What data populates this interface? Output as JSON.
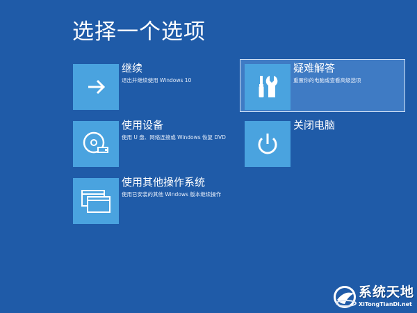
{
  "page": {
    "title": "选择一个选项"
  },
  "options": [
    {
      "title": "继续",
      "desc": "退出并继续使用 Windows 10",
      "icon": "arrow-right-icon"
    },
    {
      "title": "使用设备",
      "desc": "使用 U 盘、网络连接或 Windows 恢复 DVD",
      "icon": "disc-drive-icon"
    },
    {
      "title": "使用其他操作系统",
      "desc": "使用已安装的其他 Windows 版本继续操作",
      "icon": "windows-stack-icon"
    },
    {
      "title": "疑难解答",
      "desc": "重置你的电脑或查看高级选项",
      "icon": "tools-icon",
      "selected": true
    },
    {
      "title": "关闭电脑",
      "desc": "",
      "icon": "power-icon"
    }
  ],
  "watermark": {
    "title": "系统天地",
    "url": "XiTongTianDi.net"
  },
  "colors": {
    "background": "#1f5ba8",
    "tile": "#4aa3df",
    "selected_background": "#3f7bc4",
    "selected_border": "#cfe0f5",
    "text": "#ffffff"
  }
}
